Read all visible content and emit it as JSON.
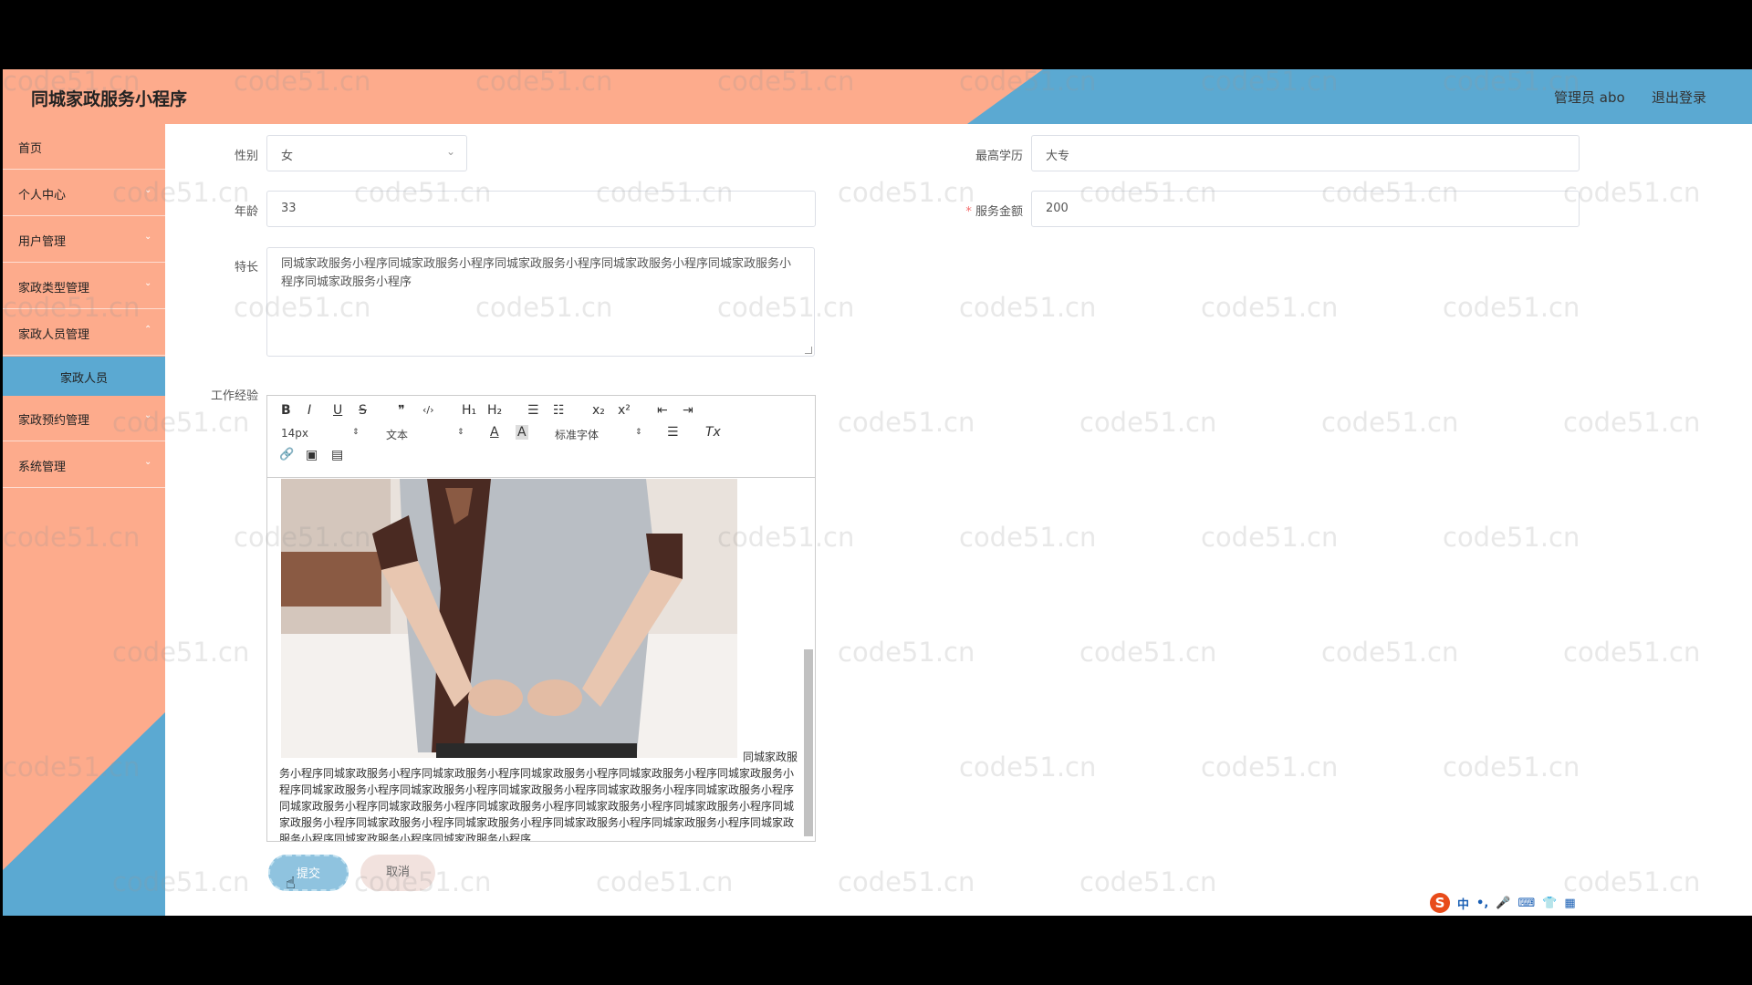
{
  "header": {
    "title": "同城家政服务小程序",
    "admin_label": "管理员 abo",
    "logout": "退出登录"
  },
  "sidebar": {
    "items": [
      {
        "label": "首页"
      },
      {
        "label": "个人中心"
      },
      {
        "label": "用户管理"
      },
      {
        "label": "家政类型管理"
      },
      {
        "label": "家政人员管理"
      },
      {
        "label": "家政人员"
      },
      {
        "label": "家政预约管理"
      },
      {
        "label": "系统管理"
      }
    ]
  },
  "form": {
    "gender": {
      "label": "性别",
      "value": "女"
    },
    "education": {
      "label": "最高学历",
      "value": "大专"
    },
    "age": {
      "label": "年龄",
      "value": "33"
    },
    "service_fee": {
      "label": "服务金额",
      "value": "200"
    },
    "specialty": {
      "label": "特长",
      "value": "同城家政服务小程序同城家政服务小程序同城家政服务小程序同城家政服务小程序同城家政服务小程序同城家政服务小程序"
    },
    "work_experience": {
      "label": "工作经验"
    }
  },
  "editor": {
    "toolbar": {
      "bold": "B",
      "italic": "I",
      "underline": "U",
      "strike": "S",
      "quote": "❞",
      "code": "‹/›",
      "h1": "H₁",
      "h2": "H₂",
      "ordered_list": "☰",
      "bullet_list": "☷",
      "sub": "x₂",
      "sup": "x²",
      "outdent": "⇤",
      "indent": "⇥",
      "size": "14px",
      "header": "文本",
      "font": "标准字体",
      "color": "A",
      "background": "A",
      "align": "☰",
      "clean": "Tx",
      "link": "🔗",
      "image": "▣",
      "video": "▤"
    },
    "content": "同城家政服务小程序同城家政服务小程序同城家政服务小程序同城家政服务小程序同城家政服务小程序同城家政服务小程序同城家政服务小程序同城家政服务小程序同城家政服务小程序同城家政服务小程序同城家政服务小程序同城家政服务小程序同城家政服务小程序同城家政服务小程序同城家政服务小程序同城家政服务小程序同城家政服务小程序同城家政服务小程序同城家政服务小程序同城家政服务小程序同城家政服务小程序同城家政服务小程序同城家政服务小程序同城家政服务小程序"
  },
  "buttons": {
    "submit": "提交",
    "cancel": "取消"
  },
  "watermark": "code51.cn",
  "ime": {
    "lang": "中",
    "punct": "•,"
  },
  "colors": {
    "salmon": "#fdab8c",
    "blue": "#5ba9d2"
  }
}
